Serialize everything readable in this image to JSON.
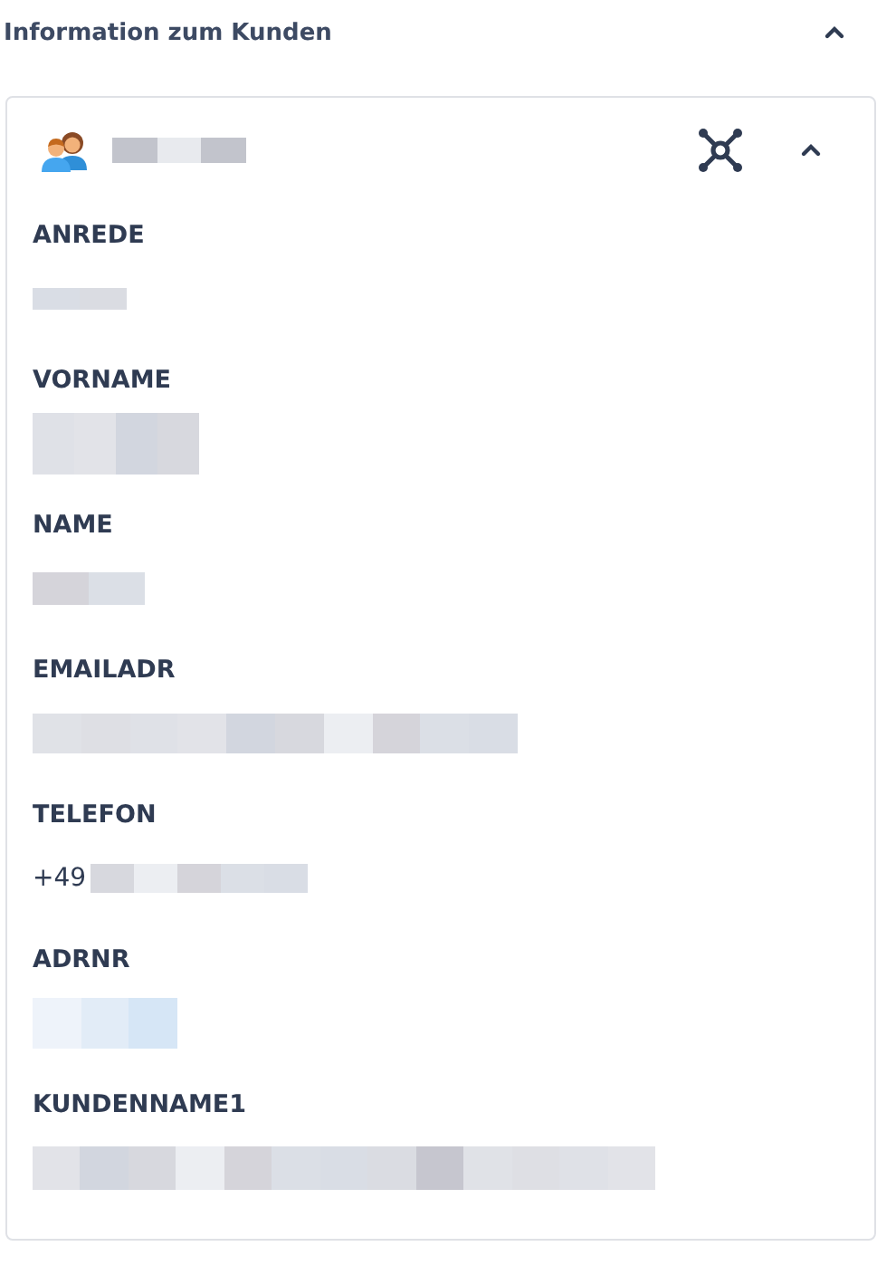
{
  "section": {
    "title": "Information zum Kunden",
    "expanded": true
  },
  "card": {
    "expanded": true,
    "name_redacted": true
  },
  "fields": [
    {
      "label": "ANREDE",
      "value_redacted": true
    },
    {
      "label": "VORNAME",
      "value_redacted": true
    },
    {
      "label": "NAME",
      "value_redacted": true
    },
    {
      "label": "EMAILADR",
      "value_redacted": true
    },
    {
      "label": "TELEFON",
      "value": "+49",
      "value_redacted": true
    },
    {
      "label": "ADRNR",
      "value_redacted": true
    },
    {
      "label": "KUNDENNAME1",
      "value_redacted": true
    }
  ]
}
